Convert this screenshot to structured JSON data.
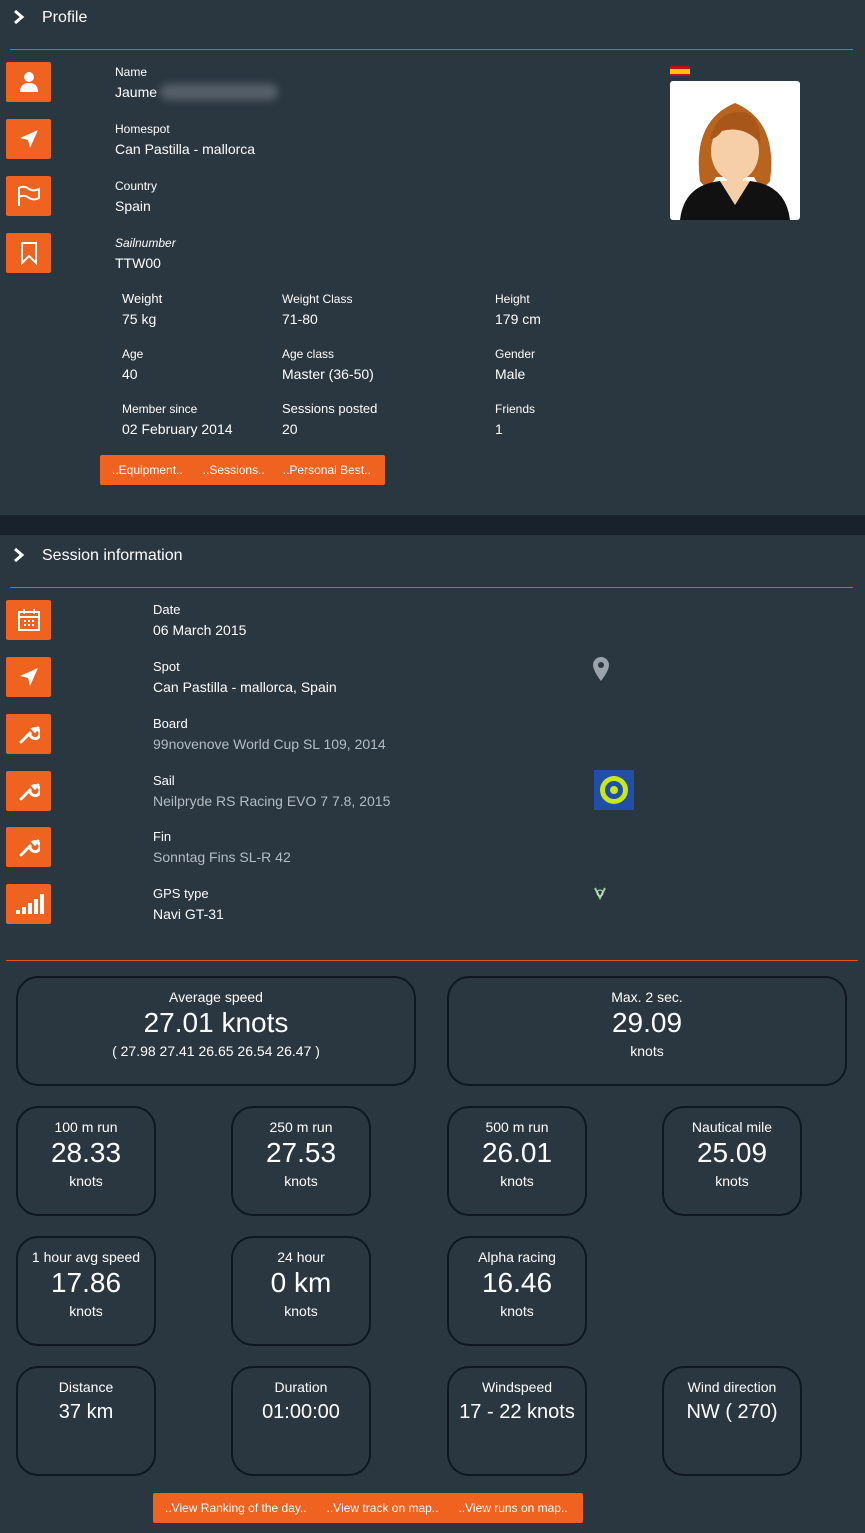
{
  "profile": {
    "title": "Profile",
    "name_label": "Name",
    "name_value": "Jaume",
    "homespot_label": "Homespot",
    "homespot_value": "Can Pastilla - mallorca",
    "country_label": "Country",
    "country_value": "Spain",
    "sailnumber_label": "Sailnumber",
    "sailnumber_value": "TTW00",
    "weight_label": "Weight",
    "weight_value": "75 kg",
    "weight_class_label": "Weight Class",
    "weight_class_value": "71-80",
    "height_label": "Height",
    "height_value": "179 cm",
    "age_label": "Age",
    "age_value": "40",
    "age_class_label": "Age class",
    "age_class_value": "Master (36-50)",
    "gender_label": "Gender",
    "gender_value": "Male",
    "member_since_label": "Member since",
    "member_since_value": "02 February 2014",
    "sessions_posted_label": "Sessions posted",
    "sessions_posted_value": "20",
    "friends_label": "Friends",
    "friends_value": "1",
    "buttons": {
      "equipment": "..Equipment..",
      "sessions": "..Sessions..",
      "personal_best": "..Personal Best.."
    }
  },
  "session": {
    "title": "Session information",
    "date_label": "Date",
    "date_value": "06 March 2015",
    "spot_label": "Spot",
    "spot_value": "Can Pastilla - mallorca, Spain",
    "board_label": "Board",
    "board_value": "99novenove World Cup SL 109, 2014",
    "sail_label": "Sail",
    "sail_value": "Neilpryde RS Racing EVO 7 7.8, 2015",
    "fin_label": "Fin",
    "fin_value": "Sonntag Fins SL-R 42",
    "gps_label": "GPS type",
    "gps_value": "Navi GT-31"
  },
  "stats": {
    "avg_speed": {
      "title": "Average speed",
      "value": "27.01 knots",
      "detail": "( 27.98 27.41 26.65 26.54 26.47 )"
    },
    "max2": {
      "title": "Max. 2 sec.",
      "value": "29.09",
      "unit": "knots"
    },
    "run100": {
      "title": "100 m run",
      "value": "28.33",
      "unit": "knots"
    },
    "run250": {
      "title": "250 m run",
      "value": "27.53",
      "unit": "knots"
    },
    "run500": {
      "title": "500 m run",
      "value": "26.01",
      "unit": "knots"
    },
    "nautical": {
      "title": "Nautical mile",
      "value": "25.09",
      "unit": "knots"
    },
    "hour": {
      "title": "1 hour avg speed",
      "value": "17.86",
      "unit": "knots"
    },
    "h24": {
      "title": "24 hour",
      "value": "0 km",
      "unit": "knots"
    },
    "alpha": {
      "title": "Alpha racing",
      "value": "16.46",
      "unit": "knots"
    },
    "distance": {
      "title": "Distance",
      "value": "37 km"
    },
    "duration": {
      "title": "Duration",
      "value": "01:00:00"
    },
    "windspeed": {
      "title": "Windspeed",
      "value": "17 - 22 knots"
    },
    "winddir": {
      "title": "Wind direction",
      "value": "NW ( 270)"
    }
  },
  "bottom_buttons": {
    "ranking": "..View Ranking of the day..",
    "track": "..View track on map..",
    "runs": "..View runs on map.."
  },
  "colors": {
    "accent": "#f0621f",
    "background": "#2a3640",
    "separator": "#18222d"
  }
}
